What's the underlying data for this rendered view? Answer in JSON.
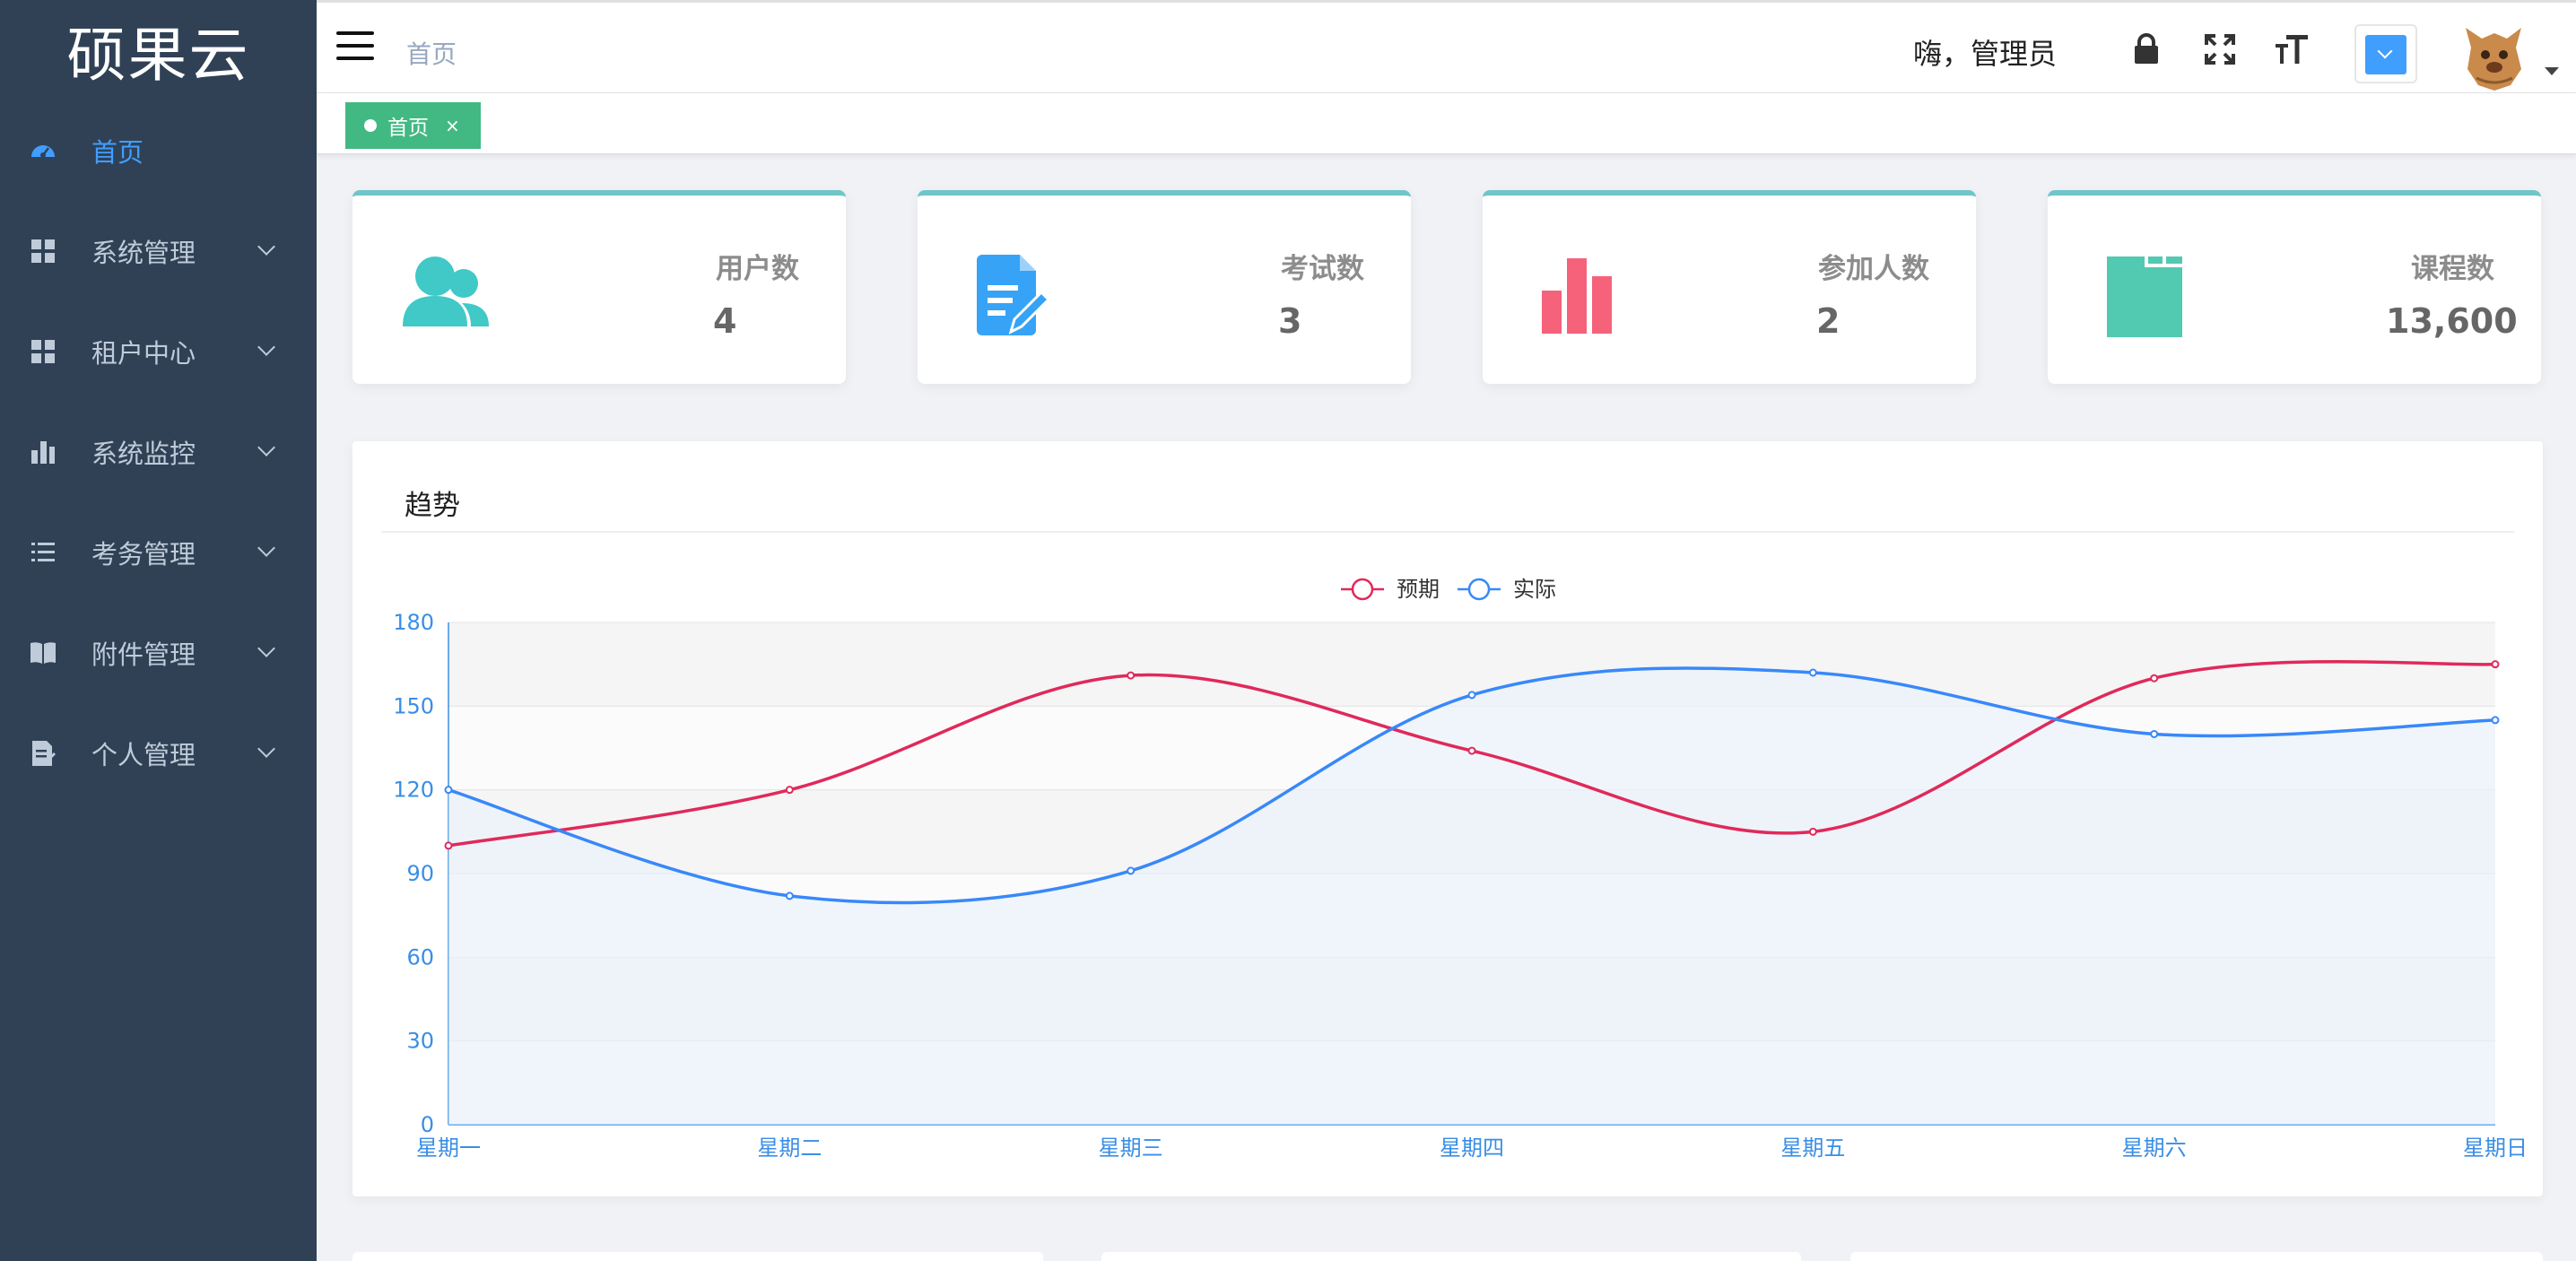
{
  "sidebar": {
    "logo": "硕果云",
    "items": [
      {
        "label": "首页",
        "icon": "dashboard-icon",
        "active": true
      },
      {
        "label": "系统管理",
        "icon": "grid-icon"
      },
      {
        "label": "租户中心",
        "icon": "grid-icon"
      },
      {
        "label": "系统监控",
        "icon": "bar-chart-icon"
      },
      {
        "label": "考务管理",
        "icon": "list-icon"
      },
      {
        "label": "附件管理",
        "icon": "book-icon"
      },
      {
        "label": "个人管理",
        "icon": "document-icon"
      }
    ]
  },
  "navbar": {
    "breadcrumb": "首页",
    "greeting": "嗨，管理员",
    "theme_color": "#409eff"
  },
  "tags": [
    {
      "label": "首页",
      "close": "×"
    }
  ],
  "stats": [
    {
      "label": "用户数",
      "value": "4",
      "color": "#40c9c6",
      "icon": "users-icon"
    },
    {
      "label": "考试数",
      "value": "3",
      "color": "#36a3f7",
      "icon": "edit-document-icon"
    },
    {
      "label": "参加人数",
      "value": "2",
      "color": "#f4516c",
      "icon": "bar-chart-icon"
    },
    {
      "label": "课程数",
      "value": "13,600",
      "color": "#34bfa3",
      "icon": "window-icon"
    }
  ],
  "trend": {
    "title": "趋势"
  },
  "chart_data": {
    "type": "line",
    "title": "",
    "xlabel": "",
    "ylabel": "",
    "categories": [
      "星期一",
      "星期二",
      "星期三",
      "星期四",
      "星期五",
      "星期六",
      "星期日"
    ],
    "ylim": [
      0,
      180
    ],
    "yticks": [
      0,
      30,
      60,
      90,
      120,
      150,
      180
    ],
    "legend_position": "top-center",
    "smooth": true,
    "series": [
      {
        "name": "预期",
        "color": "#e0295a",
        "values": [
          100,
          120,
          161,
          134,
          105,
          160,
          165
        ]
      },
      {
        "name": "实际",
        "color": "#3888fa",
        "values": [
          120,
          82,
          91,
          154,
          162,
          140,
          145
        ],
        "area": true
      }
    ]
  }
}
